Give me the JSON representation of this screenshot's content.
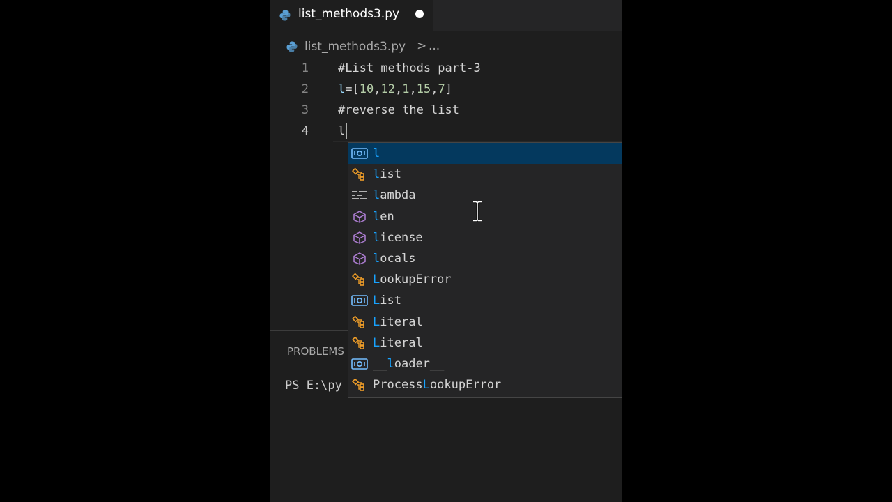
{
  "tab": {
    "filename": "list_methods3.py",
    "unsaved_icon": "dot-icon"
  },
  "breadcrumb": {
    "file": "list_methods3.py",
    "separator": ">",
    "more": "..."
  },
  "editor": {
    "lines": [
      {
        "number": "1",
        "text": "#List methods part-3"
      },
      {
        "number": "2",
        "prefix": "l",
        "eq": "=[",
        "nums": [
          "10",
          "12",
          "1",
          "15",
          "7"
        ],
        "close": "]"
      },
      {
        "number": "3",
        "text": "#reverse the list"
      },
      {
        "number": "4",
        "text": "l"
      }
    ]
  },
  "panel": {
    "tab": "PROBLEMS",
    "terminal_prompt": "PS E:\\py"
  },
  "suggestions": {
    "query": "l",
    "items": [
      {
        "icon": "variable-icon",
        "match": "l",
        "rest": ""
      },
      {
        "icon": "class-icon",
        "match": "l",
        "rest": "ist"
      },
      {
        "icon": "keyword-icon",
        "match": "l",
        "rest": "ambda"
      },
      {
        "icon": "function-icon",
        "match": "l",
        "rest": "en"
      },
      {
        "icon": "function-icon",
        "match": "l",
        "rest": "icense"
      },
      {
        "icon": "function-icon",
        "match": "l",
        "rest": "ocals"
      },
      {
        "icon": "class-icon",
        "match": "L",
        "rest": "ookupError"
      },
      {
        "icon": "variable-icon",
        "match": "L",
        "rest": "ist"
      },
      {
        "icon": "class-icon",
        "match": "L",
        "rest": "iteral"
      },
      {
        "icon": "class-icon",
        "match": "L",
        "rest": "iteral"
      },
      {
        "icon": "variable-icon",
        "pre": "__",
        "match": "l",
        "rest": "oader__"
      },
      {
        "icon": "class-icon",
        "pre": "Process",
        "match": "L",
        "rest": "ookupError"
      }
    ]
  },
  "colors": {
    "editor_bg": "#1e1e1e",
    "comment": "#6a9955",
    "variable": "#9cdcfe",
    "number": "#b5cea8",
    "selection": "#04395e",
    "match_highlight": "#18a3ff",
    "class_icon": "#ee9d28",
    "function_icon": "#b180d7"
  }
}
